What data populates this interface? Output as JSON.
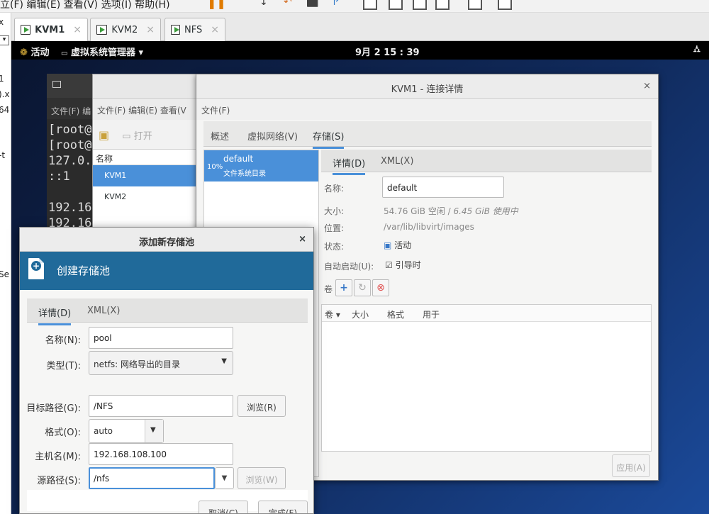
{
  "host": {
    "toolbar_fragment": "立(F) 编辑(E) 查看(V) 选项(I) 帮助(H)",
    "left_fragments": [
      "x",
      "1",
      ").x",
      "64",
      "-t",
      "Se"
    ],
    "tabs": [
      {
        "label": "KVM1",
        "active": true
      },
      {
        "label": "KVM2",
        "active": false
      },
      {
        "label": "NFS",
        "active": false
      }
    ],
    "tab_close": "×"
  },
  "guest_topbar": {
    "activities": "活动",
    "app_menu": "虚拟系统管理器 ▾",
    "clock": "9月 2 15 : 39",
    "network_icon": "network-icon"
  },
  "terminal": {
    "menu": "文件(F) 编",
    "lines": [
      "[root@",
      "[root@",
      "127.0.",
      "::1",
      "",
      "192.16",
      "192.16"
    ]
  },
  "vmm": {
    "menu": "文件(F) 编辑(E) 查看(V",
    "toolbar_open": "打开",
    "col_name": "名称",
    "rows": [
      "KVM1",
      "KVM2"
    ]
  },
  "conn": {
    "title": "KVM1 - 连接详情",
    "close": "×",
    "menu": "文件(F)",
    "tabs": [
      "概述",
      "虚拟网络(V)",
      "存储(S)"
    ],
    "pool": {
      "percent": "10%",
      "name": "default",
      "type": "文件系统目录"
    },
    "detail_tabs": [
      "详情(D)",
      "XML(X)"
    ],
    "fields": {
      "name_label": "名称:",
      "name_value": "default",
      "size_label": "大小:",
      "size_free": "54.76 GiB 空闲 / ",
      "size_used": "6.45 GiB 使用中",
      "location_label": "位置:",
      "location_value": "/var/lib/libvirt/images",
      "state_label": "状态:",
      "state_value": "活动",
      "autostart_label": "自动启动(U):",
      "autostart_value": "引导时"
    },
    "volumes_label": "卷",
    "vol_columns": [
      "卷 ▾",
      "大小",
      "格式",
      "用于"
    ],
    "apply": "应用(A)"
  },
  "addpool": {
    "title": "添加新存储池",
    "close": "×",
    "banner": "创建存储池",
    "tabs": [
      "详情(D)",
      "XML(X)"
    ],
    "labels": {
      "name": "名称(N):",
      "type": "类型(T):",
      "target": "目标路径(G):",
      "format": "格式(O):",
      "host": "主机名(M):",
      "source": "源路径(S):"
    },
    "values": {
      "name": "pool",
      "type": "netfs: 网络导出的目录",
      "target": "/NFS",
      "format": "auto",
      "host": "192.168.108.100",
      "source": "/nfs"
    },
    "browse_target": "浏览(R)",
    "browse_source": "浏览(W)",
    "cancel": "取消(C)",
    "finish": "完成(F)"
  }
}
